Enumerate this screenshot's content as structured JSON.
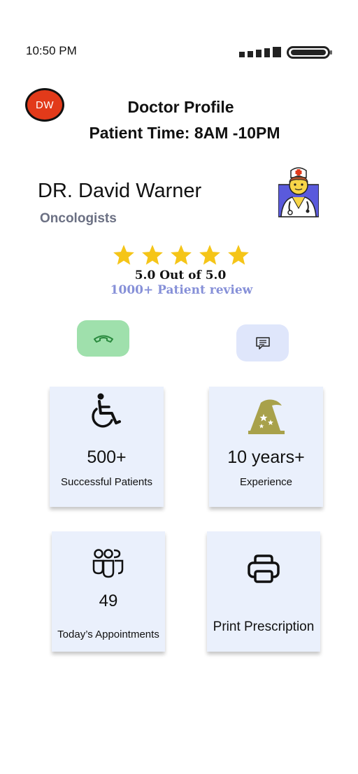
{
  "status_bar": {
    "time": "10:50 PM"
  },
  "header": {
    "avatar_initials": "DW",
    "title": "Doctor Profile",
    "patient_time": "Patient Time: 8AM -10PM"
  },
  "doctor": {
    "name": "DR. David Warner",
    "specialty": "Oncologists",
    "image_icon": "doctor-avatar-icon"
  },
  "rating": {
    "stars": 5,
    "max_stars": 5,
    "score_text": "5.0 Out of 5.0",
    "reviews_text": "1000+ Patient review",
    "star_color": "#f5c518"
  },
  "actions": {
    "call_icon": "phone-icon",
    "message_icon": "message-icon"
  },
  "stats": [
    {
      "icon": "wheelchair-icon",
      "value": "500+",
      "label": "Successful Patients"
    },
    {
      "icon": "wizard-hat-icon",
      "value": "10 years+",
      "label": "Experience"
    },
    {
      "icon": "people-group-icon",
      "value": "49",
      "label": "Today’s Appointments"
    },
    {
      "icon": "printer-icon",
      "value": "",
      "label": "Print Prescription"
    }
  ],
  "colors": {
    "avatar_bg": "#e23a1a",
    "call_bg": "#9fe0ac",
    "message_bg": "#dfe6fb",
    "card_bg": "#eaf0fc",
    "specialty_text": "#6b7083",
    "review_text": "#8690d8"
  }
}
